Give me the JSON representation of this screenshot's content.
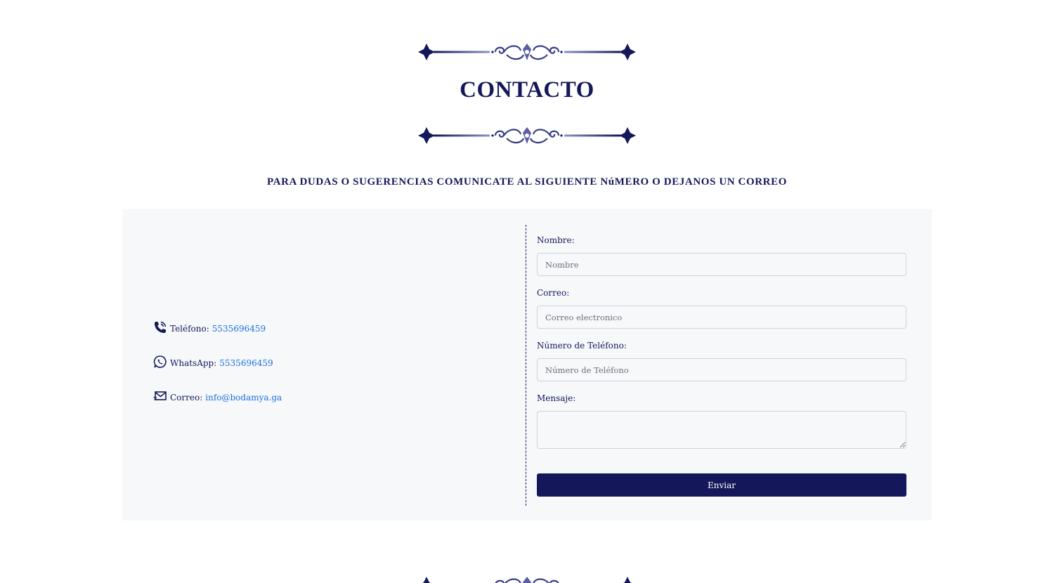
{
  "page": {
    "title": "CONTACTO",
    "subtitle": "PARA DUDAS O SUGERENCIAS COMUNICATE AL SIGUIENTE NúMERO O DEJANOS UN CORREO"
  },
  "contact_info": [
    {
      "icon": "phone-icon",
      "label": "Teléfono:",
      "value": "5535696459"
    },
    {
      "icon": "whatsapp-icon",
      "label": "WhatsApp:",
      "value": "5535696459"
    },
    {
      "icon": "mail-icon",
      "label": "Correo:",
      "value": "info@bodamya.ga"
    }
  ],
  "form": {
    "name_label": "Nombre:",
    "name_placeholder": "Nombre",
    "email_label": "Correo:",
    "email_placeholder": "Correo electronico",
    "phone_label": "Número de Teléfono:",
    "phone_placeholder": "Número de Teléfono",
    "message_label": "Mensaje:",
    "message_placeholder": "",
    "submit_label": "Enviar"
  },
  "colors": {
    "primary": "#14185a",
    "link": "#1f6fe0",
    "card_background": "#f6f8fa"
  }
}
